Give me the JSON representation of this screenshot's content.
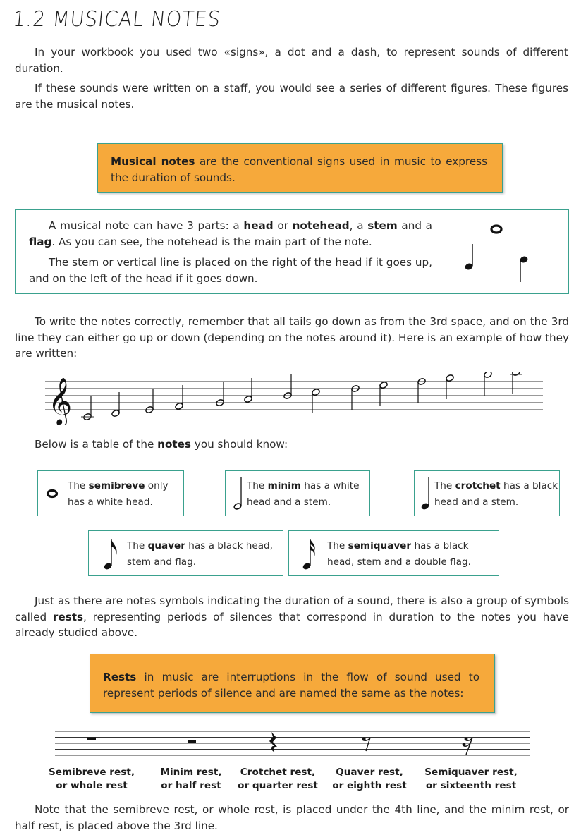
{
  "title": "1.2 MUSICAL NOTES",
  "intro": {
    "p1": "In your workbook you used two «signs», a dot and a dash, to represent sounds of different duration.",
    "p2": "If these sounds were written on a staff, you would see a series of different figures. These figures are the musical notes."
  },
  "definition_notes": {
    "term": "Musical notes",
    "rest": " are the conventional signs used in music to express the duration of sounds."
  },
  "parts": {
    "p1_a": "A musical note can have 3 parts: a ",
    "head": "head",
    "p1_b": " or ",
    "notehead": "notehead",
    "p1_c": ", a ",
    "stem": "stem",
    "p1_d": " and a ",
    "flag": "flag",
    "p1_e": ". As you can see, the notehead is the main part of the note.",
    "p2": "The stem or vertical line is placed on the right of the head if it goes up, and on the left of the head if it goes down."
  },
  "writing": {
    "p": "To write the notes correctly, remember that all tails go down as from the 3rd space, and on the 3rd line they can either go up or down (depending on the notes around it). Here is an example of how they are written:"
  },
  "table_intro": {
    "a": "Below is a table of the ",
    "b": "notes",
    "c": " you should know:"
  },
  "note_types": [
    {
      "pre": "The ",
      "name": "semibreve",
      "post": " only has a white head."
    },
    {
      "pre": "The ",
      "name": "minim",
      "post": " has a white head and a stem."
    },
    {
      "pre": "The ",
      "name": "crotchet",
      "post": " has a black head and a stem."
    },
    {
      "pre": "The ",
      "name": "quaver",
      "post": " has a black head, stem and flag."
    },
    {
      "pre": "The ",
      "name": "semiquaver",
      "post": " has a black head, stem and a double flag."
    }
  ],
  "rests_intro": {
    "a": "Just as there are notes symbols indicating the duration of a sound, there is also a group of symbols called ",
    "b": "rests",
    "c": ", representing periods of silences that correspond in duration to the notes you have already studied above."
  },
  "definition_rests": {
    "term": "Rests",
    "rest": " in music are interruptions in the flow of sound used to represent periods of silence and are named the same as the notes:"
  },
  "rest_labels": [
    {
      "l1": "Semibreve rest,",
      "l2": "or whole rest"
    },
    {
      "l1": "Minim rest,",
      "l2": "or half rest"
    },
    {
      "l1": "Crotchet rest,",
      "l2": "or quarter rest"
    },
    {
      "l1": "Quaver rest,",
      "l2": "or eighth rest"
    },
    {
      "l1": "Semiquaver rest,",
      "l2": "or sixteenth rest"
    }
  ],
  "closing": "Note that the semibreve rest, or whole rest, is placed under the 4th line, and the minim rest, or half rest, is placed above the 3rd line.",
  "colors": {
    "accent_orange": "#f6a93b",
    "border_teal": "#3aa18e",
    "text": "#2b2b2b"
  }
}
